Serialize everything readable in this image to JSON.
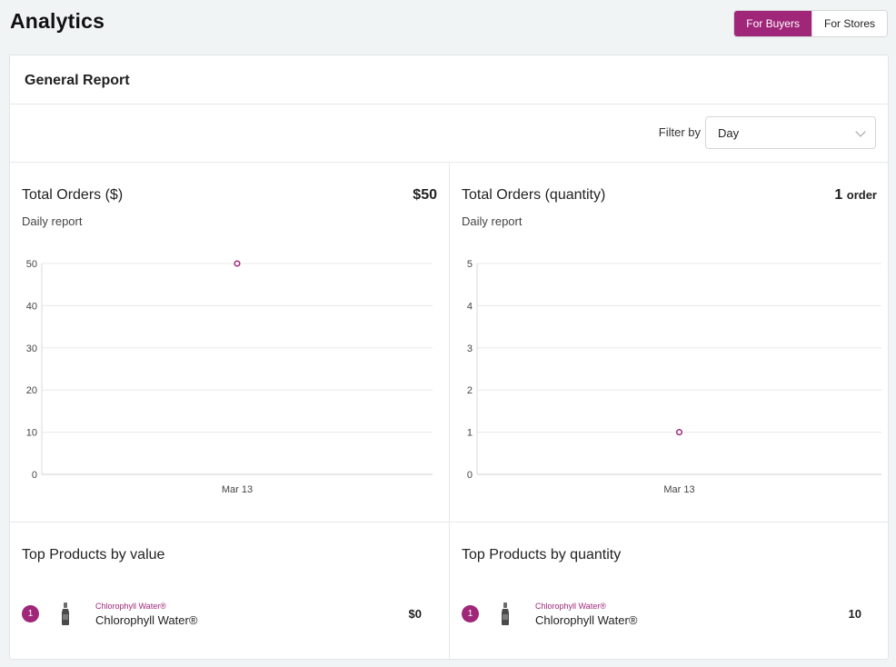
{
  "page": {
    "title": "Analytics"
  },
  "toggle": {
    "buyers": "For Buyers",
    "stores": "For Stores",
    "active": "buyers"
  },
  "report": {
    "title": "General Report",
    "filter_label": "Filter by",
    "filter_value": "Day"
  },
  "colors": {
    "accent": "#a0267a"
  },
  "panels": {
    "orders_value": {
      "title": "Total Orders ($)",
      "metric": "$50",
      "subtitle": "Daily report"
    },
    "orders_qty": {
      "title": "Total Orders (quantity)",
      "metric_number": "1",
      "metric_unit": "order",
      "subtitle": "Daily report"
    },
    "top_value": {
      "title": "Top Products by value",
      "items": [
        {
          "rank": "1",
          "category": "Chlorophyll Water®",
          "name": "Chlorophyll Water®",
          "value": "$0"
        }
      ]
    },
    "top_qty": {
      "title": "Top Products by quantity",
      "items": [
        {
          "rank": "1",
          "category": "Chlorophyll Water®",
          "name": "Chlorophyll Water®",
          "value": "10"
        }
      ]
    }
  },
  "chart_data": [
    {
      "type": "scatter",
      "title": "Total Orders ($)",
      "subtitle": "Daily report",
      "x": [
        "Mar 13"
      ],
      "values": [
        50
      ],
      "yticks": [
        0,
        10,
        20,
        30,
        40,
        50
      ],
      "ylim": [
        0,
        50
      ],
      "grid": true
    },
    {
      "type": "scatter",
      "title": "Total Orders (quantity)",
      "subtitle": "Daily report",
      "x": [
        "Mar 13"
      ],
      "values": [
        1
      ],
      "yticks": [
        0,
        1,
        2,
        3,
        4,
        5
      ],
      "ylim": [
        0,
        5
      ],
      "grid": true
    }
  ]
}
